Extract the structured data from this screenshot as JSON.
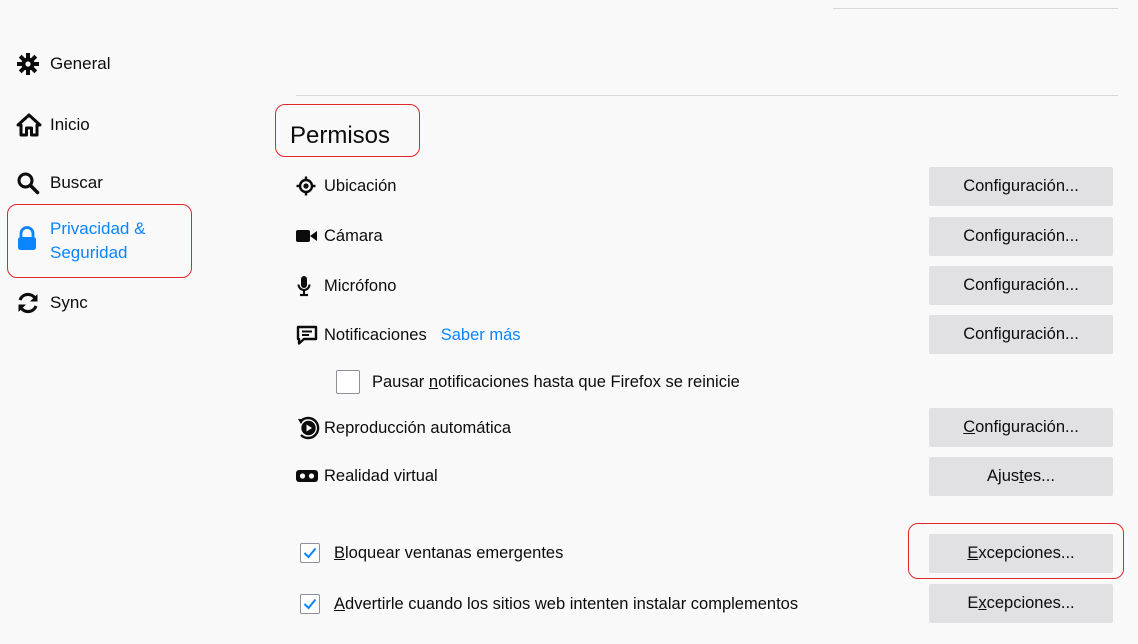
{
  "sidebar": {
    "items": [
      {
        "label": "General",
        "icon": "gear-icon",
        "selected": false
      },
      {
        "label": "Inicio",
        "icon": "home-icon",
        "selected": false
      },
      {
        "label": "Buscar",
        "icon": "search-icon",
        "selected": false
      },
      {
        "label": "Privacidad & Seguridad",
        "icon": "lock-icon",
        "selected": true
      },
      {
        "label": "Sync",
        "icon": "sync-icon",
        "selected": false
      }
    ]
  },
  "permissions": {
    "title": "Permisos",
    "location": {
      "label": "Ubicación",
      "icon": "location-icon",
      "button": "Configuración..."
    },
    "camera": {
      "label": "Cámara",
      "icon": "camera-icon",
      "button": "Configuración..."
    },
    "microphone": {
      "label": "Micrófono",
      "icon": "microphone-icon",
      "button": "Configuración..."
    },
    "notifications": {
      "label": "Notificaciones",
      "link": "Saber más",
      "icon": "notification-icon",
      "button": "Configuración..."
    },
    "pause_notifications": {
      "label": "Pausar notificaciones hasta que Firefox se reinicie",
      "checked": false
    },
    "autoplay": {
      "label": "Reproducción automática",
      "icon": "autoplay-icon",
      "button": "Configuración..."
    },
    "vr": {
      "label": "Realidad virtual",
      "icon": "vr-icon",
      "button": "Ajustes..."
    },
    "block_popups": {
      "label": "Bloquear ventanas emergentes",
      "checked": true,
      "button": "Excepciones..."
    },
    "warn_addons": {
      "label": "Advertirle cuando los sitios web intenten instalar complementos",
      "checked": true,
      "button": "Excepciones..."
    }
  },
  "colors": {
    "accent": "#0a84ff",
    "highlight": "#e0252c",
    "button_bg": "#e1e1e3",
    "background": "#f9f9fa"
  }
}
